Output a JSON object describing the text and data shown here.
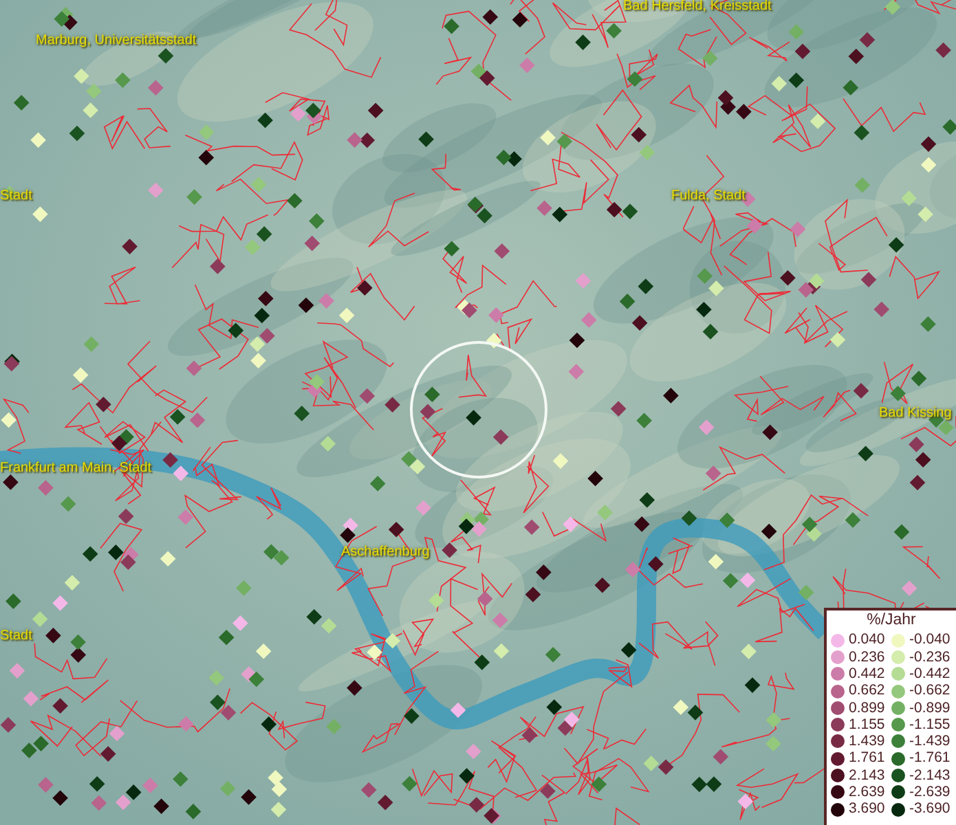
{
  "map": {
    "places": [
      {
        "name": "Marburg, Universitätsstadt"
      },
      {
        "name": "Bad Hersfeld, Kreisstadt"
      },
      {
        "name": "Stadt"
      },
      {
        "name": "Fulda, Stadt"
      },
      {
        "name": "Bad Kissing"
      },
      {
        "name": "Frankfurt am Main, Stadt"
      },
      {
        "name": "Aschaffenburg"
      },
      {
        "name": "Stadt"
      }
    ]
  },
  "legend": {
    "title": "%/Jahr",
    "columns": [
      {
        "entries": [
          {
            "value": "0.040",
            "color": "#f4b8e8"
          },
          {
            "value": "0.236",
            "color": "#e4a0cc"
          },
          {
            "value": "0.442",
            "color": "#cc7ca8"
          },
          {
            "value": "0.662",
            "color": "#b8648c"
          },
          {
            "value": "0.899",
            "color": "#a04c70"
          },
          {
            "value": "1.155",
            "color": "#8c3a5a"
          },
          {
            "value": "1.439",
            "color": "#782a44"
          },
          {
            "value": "1.761",
            "color": "#621a30"
          },
          {
            "value": "2.143",
            "color": "#4c1020"
          },
          {
            "value": "2.639",
            "color": "#360814"
          },
          {
            "value": "3.690",
            "color": "#22040a"
          }
        ]
      },
      {
        "entries": [
          {
            "value": "-0.040",
            "color": "#f0f8c0"
          },
          {
            "value": "-0.236",
            "color": "#d4ecac"
          },
          {
            "value": "-0.442",
            "color": "#b4dc94"
          },
          {
            "value": "-0.662",
            "color": "#94c87c"
          },
          {
            "value": "-0.899",
            "color": "#74b064"
          },
          {
            "value": "-1.155",
            "color": "#56984c"
          },
          {
            "value": "-1.439",
            "color": "#3c803a"
          },
          {
            "value": "-1.761",
            "color": "#2a6a2a"
          },
          {
            "value": "-2.143",
            "color": "#1a5220"
          },
          {
            "value": "-2.639",
            "color": "#0e3c16"
          },
          {
            "value": "-3.690",
            "color": "#06280e"
          }
        ]
      }
    ]
  }
}
